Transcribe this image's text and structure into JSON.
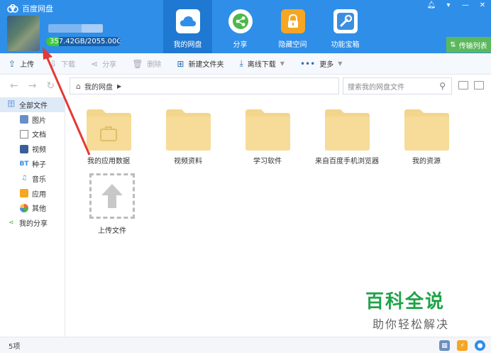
{
  "app": {
    "title": "百度网盘"
  },
  "account": {
    "quota_text": "357.42GB/2055.00GB",
    "quota_used_fraction": 0.174
  },
  "nav_tabs": [
    {
      "label": "我的网盘",
      "icon": "cloud-icon",
      "active": true
    },
    {
      "label": "分享",
      "icon": "share-icon",
      "active": false
    },
    {
      "label": "隐藏空间",
      "icon": "lock-icon",
      "active": false
    },
    {
      "label": "功能宝箱",
      "icon": "tools-icon",
      "active": false
    }
  ],
  "transfer_list_label": "传输列表",
  "toolbar": {
    "upload": "上传",
    "download": "下载",
    "share": "分享",
    "delete": "删除",
    "new_folder": "新建文件夹",
    "offline_download": "离线下载",
    "more": "更多"
  },
  "breadcrumb": {
    "root": "我的网盘"
  },
  "search": {
    "placeholder": "搜索我的网盘文件"
  },
  "sidebar": {
    "all_files": "全部文件",
    "items": [
      "图片",
      "文档",
      "视频",
      "种子",
      "音乐",
      "应用",
      "其他"
    ],
    "my_share": "我的分享"
  },
  "folders": [
    {
      "name": "我的应用数据"
    },
    {
      "name": "视频资料"
    },
    {
      "name": "学习软件"
    },
    {
      "name": "来自百度手机浏览器"
    },
    {
      "name": "我的资源"
    }
  ],
  "upload_tile": {
    "label": "上传文件"
  },
  "watermark": {
    "line1": "百科全说",
    "line2": "助你轻松解决"
  },
  "status": {
    "count_text": "5项"
  },
  "colors": {
    "header_blue": "#2f8ee8",
    "folder_yellow": "#f6d98c",
    "green_accent": "#5cb85c"
  }
}
